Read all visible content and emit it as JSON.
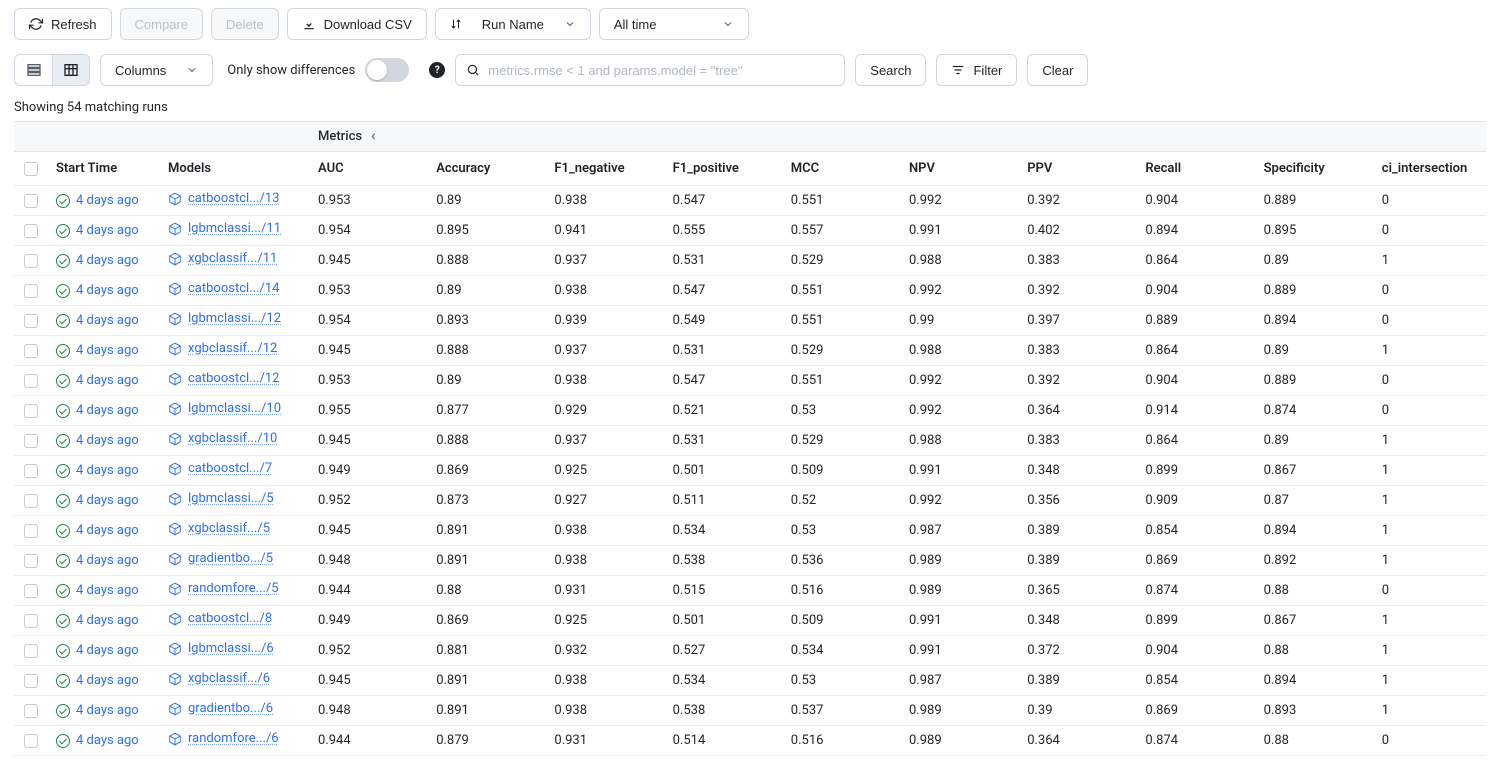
{
  "toolbar": {
    "refresh": "Refresh",
    "compare": "Compare",
    "delete": "Delete",
    "download_csv": "Download CSV",
    "sort_select": "Run Name",
    "time_select": "All time",
    "columns": "Columns",
    "only_diff": "Only show differences",
    "search_placeholder": "metrics.rmse < 1 and params.model = \"tree\"",
    "search_btn": "Search",
    "filter_btn": "Filter",
    "clear_btn": "Clear"
  },
  "count_text": "Showing 54 matching runs",
  "group_label": "Metrics",
  "columns": [
    "Start Time",
    "Models",
    "AUC",
    "Accuracy",
    "F1_negative",
    "F1_positive",
    "MCC",
    "NPV",
    "PPV",
    "Recall",
    "Specificity",
    "ci_intersection"
  ],
  "rows": [
    {
      "time": "4 days ago",
      "model": "catboostcl.../13",
      "AUC": "0.953",
      "Accuracy": "0.89",
      "F1_negative": "0.938",
      "F1_positive": "0.547",
      "MCC": "0.551",
      "NPV": "0.992",
      "PPV": "0.392",
      "Recall": "0.904",
      "Specificity": "0.889",
      "ci_intersection": "0"
    },
    {
      "time": "4 days ago",
      "model": "lgbmclassi.../11",
      "AUC": "0.954",
      "Accuracy": "0.895",
      "F1_negative": "0.941",
      "F1_positive": "0.555",
      "MCC": "0.557",
      "NPV": "0.991",
      "PPV": "0.402",
      "Recall": "0.894",
      "Specificity": "0.895",
      "ci_intersection": "0"
    },
    {
      "time": "4 days ago",
      "model": "xgbclassif.../11",
      "AUC": "0.945",
      "Accuracy": "0.888",
      "F1_negative": "0.937",
      "F1_positive": "0.531",
      "MCC": "0.529",
      "NPV": "0.988",
      "PPV": "0.383",
      "Recall": "0.864",
      "Specificity": "0.89",
      "ci_intersection": "1"
    },
    {
      "time": "4 days ago",
      "model": "catboostcl.../14",
      "AUC": "0.953",
      "Accuracy": "0.89",
      "F1_negative": "0.938",
      "F1_positive": "0.547",
      "MCC": "0.551",
      "NPV": "0.992",
      "PPV": "0.392",
      "Recall": "0.904",
      "Specificity": "0.889",
      "ci_intersection": "0"
    },
    {
      "time": "4 days ago",
      "model": "lgbmclassi.../12",
      "AUC": "0.954",
      "Accuracy": "0.893",
      "F1_negative": "0.939",
      "F1_positive": "0.549",
      "MCC": "0.551",
      "NPV": "0.99",
      "PPV": "0.397",
      "Recall": "0.889",
      "Specificity": "0.894",
      "ci_intersection": "0"
    },
    {
      "time": "4 days ago",
      "model": "xgbclassif.../12",
      "AUC": "0.945",
      "Accuracy": "0.888",
      "F1_negative": "0.937",
      "F1_positive": "0.531",
      "MCC": "0.529",
      "NPV": "0.988",
      "PPV": "0.383",
      "Recall": "0.864",
      "Specificity": "0.89",
      "ci_intersection": "1"
    },
    {
      "time": "4 days ago",
      "model": "catboostcl.../12",
      "AUC": "0.953",
      "Accuracy": "0.89",
      "F1_negative": "0.938",
      "F1_positive": "0.547",
      "MCC": "0.551",
      "NPV": "0.992",
      "PPV": "0.392",
      "Recall": "0.904",
      "Specificity": "0.889",
      "ci_intersection": "0"
    },
    {
      "time": "4 days ago",
      "model": "lgbmclassi.../10",
      "AUC": "0.955",
      "Accuracy": "0.877",
      "F1_negative": "0.929",
      "F1_positive": "0.521",
      "MCC": "0.53",
      "NPV": "0.992",
      "PPV": "0.364",
      "Recall": "0.914",
      "Specificity": "0.874",
      "ci_intersection": "0"
    },
    {
      "time": "4 days ago",
      "model": "xgbclassif.../10",
      "AUC": "0.945",
      "Accuracy": "0.888",
      "F1_negative": "0.937",
      "F1_positive": "0.531",
      "MCC": "0.529",
      "NPV": "0.988",
      "PPV": "0.383",
      "Recall": "0.864",
      "Specificity": "0.89",
      "ci_intersection": "1"
    },
    {
      "time": "4 days ago",
      "model": "catboostcl.../7",
      "AUC": "0.949",
      "Accuracy": "0.869",
      "F1_negative": "0.925",
      "F1_positive": "0.501",
      "MCC": "0.509",
      "NPV": "0.991",
      "PPV": "0.348",
      "Recall": "0.899",
      "Specificity": "0.867",
      "ci_intersection": "1"
    },
    {
      "time": "4 days ago",
      "model": "lgbmclassi.../5",
      "AUC": "0.952",
      "Accuracy": "0.873",
      "F1_negative": "0.927",
      "F1_positive": "0.511",
      "MCC": "0.52",
      "NPV": "0.992",
      "PPV": "0.356",
      "Recall": "0.909",
      "Specificity": "0.87",
      "ci_intersection": "1"
    },
    {
      "time": "4 days ago",
      "model": "xgbclassif.../5",
      "AUC": "0.945",
      "Accuracy": "0.891",
      "F1_negative": "0.938",
      "F1_positive": "0.534",
      "MCC": "0.53",
      "NPV": "0.987",
      "PPV": "0.389",
      "Recall": "0.854",
      "Specificity": "0.894",
      "ci_intersection": "1"
    },
    {
      "time": "4 days ago",
      "model": "gradientbo.../5",
      "AUC": "0.948",
      "Accuracy": "0.891",
      "F1_negative": "0.938",
      "F1_positive": "0.538",
      "MCC": "0.536",
      "NPV": "0.989",
      "PPV": "0.389",
      "Recall": "0.869",
      "Specificity": "0.892",
      "ci_intersection": "1"
    },
    {
      "time": "4 days ago",
      "model": "randomfore.../5",
      "AUC": "0.944",
      "Accuracy": "0.88",
      "F1_negative": "0.931",
      "F1_positive": "0.515",
      "MCC": "0.516",
      "NPV": "0.989",
      "PPV": "0.365",
      "Recall": "0.874",
      "Specificity": "0.88",
      "ci_intersection": "0"
    },
    {
      "time": "4 days ago",
      "model": "catboostcl.../8",
      "AUC": "0.949",
      "Accuracy": "0.869",
      "F1_negative": "0.925",
      "F1_positive": "0.501",
      "MCC": "0.509",
      "NPV": "0.991",
      "PPV": "0.348",
      "Recall": "0.899",
      "Specificity": "0.867",
      "ci_intersection": "1"
    },
    {
      "time": "4 days ago",
      "model": "lgbmclassi.../6",
      "AUC": "0.952",
      "Accuracy": "0.881",
      "F1_negative": "0.932",
      "F1_positive": "0.527",
      "MCC": "0.534",
      "NPV": "0.991",
      "PPV": "0.372",
      "Recall": "0.904",
      "Specificity": "0.88",
      "ci_intersection": "1"
    },
    {
      "time": "4 days ago",
      "model": "xgbclassif.../6",
      "AUC": "0.945",
      "Accuracy": "0.891",
      "F1_negative": "0.938",
      "F1_positive": "0.534",
      "MCC": "0.53",
      "NPV": "0.987",
      "PPV": "0.389",
      "Recall": "0.854",
      "Specificity": "0.894",
      "ci_intersection": "1"
    },
    {
      "time": "4 days ago",
      "model": "gradientbo.../6",
      "AUC": "0.948",
      "Accuracy": "0.891",
      "F1_negative": "0.938",
      "F1_positive": "0.538",
      "MCC": "0.537",
      "NPV": "0.989",
      "PPV": "0.39",
      "Recall": "0.869",
      "Specificity": "0.893",
      "ci_intersection": "1"
    },
    {
      "time": "4 days ago",
      "model": "randomfore.../6",
      "AUC": "0.944",
      "Accuracy": "0.879",
      "F1_negative": "0.931",
      "F1_positive": "0.514",
      "MCC": "0.516",
      "NPV": "0.989",
      "PPV": "0.364",
      "Recall": "0.874",
      "Specificity": "0.88",
      "ci_intersection": "0"
    }
  ]
}
